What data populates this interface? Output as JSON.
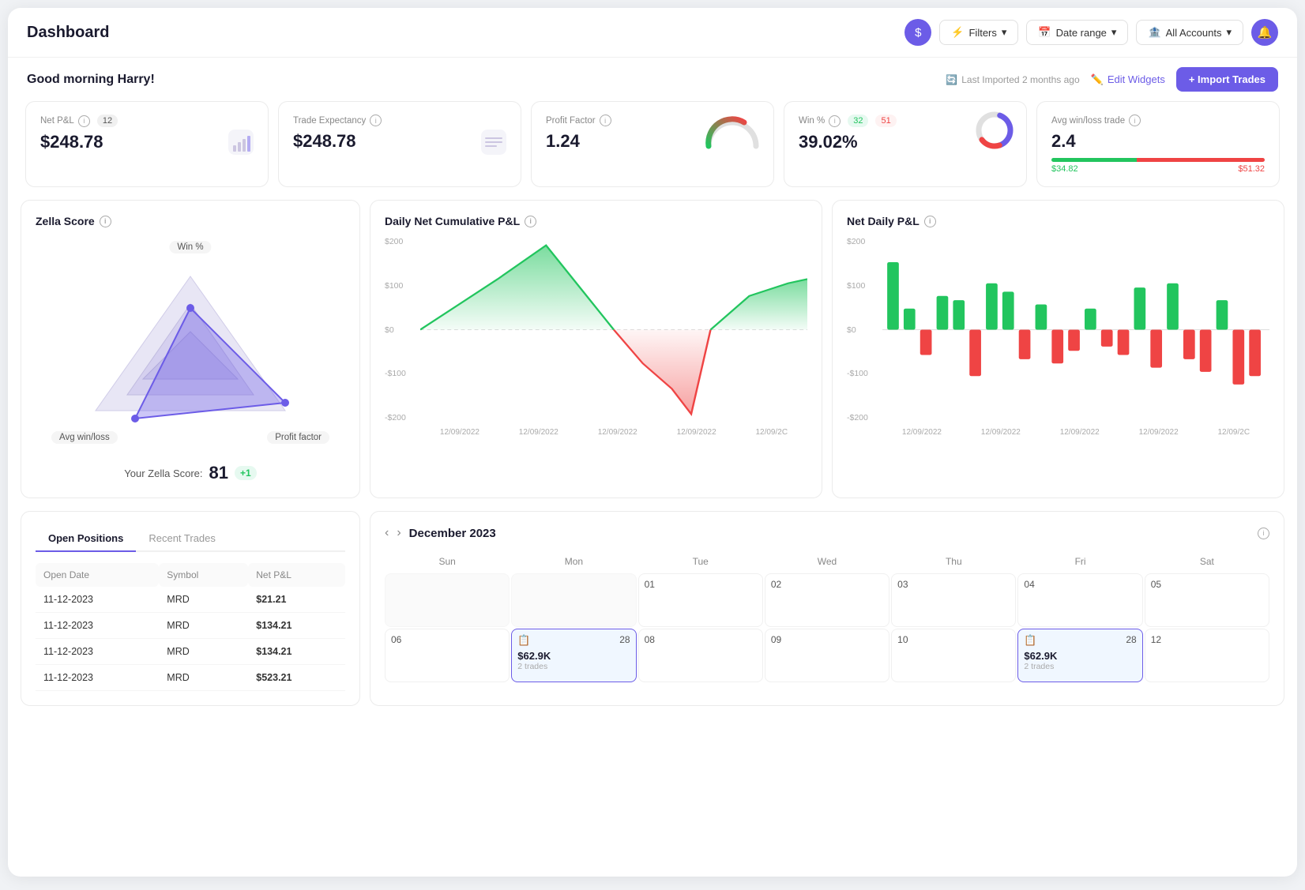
{
  "header": {
    "title": "Dashboard",
    "filters_label": "Filters",
    "date_range_label": "Date range",
    "all_accounts_label": "All Accounts"
  },
  "sub_header": {
    "greeting": "Good morning Harry!",
    "last_imported": "Last Imported 2 months ago",
    "edit_widgets_label": "Edit Widgets",
    "import_trades_label": "+ Import Trades"
  },
  "kpi": {
    "net_pnl": {
      "label": "Net P&L",
      "badge": "12",
      "value": "$248.78"
    },
    "trade_expectancy": {
      "label": "Trade Expectancy",
      "value": "$248.78"
    },
    "profit_factor": {
      "label": "Profit Factor",
      "value": "1.24"
    },
    "win_pct": {
      "label": "Win %",
      "badge_green": "32",
      "badge_red": "51",
      "value": "39.02%"
    },
    "avg_win_loss": {
      "label": "Avg win/loss trade",
      "value": "2.4",
      "green_label": "$34.82",
      "red_label": "$51.32"
    }
  },
  "zella": {
    "title": "Zella Score",
    "label_top": "Win %",
    "label_bl": "Avg win/loss",
    "label_br": "Profit factor",
    "score_label": "Your Zella Score:",
    "score": "81",
    "delta": "+1"
  },
  "daily_pnl": {
    "title": "Daily Net Cumulative P&L",
    "y_labels": [
      "$200",
      "$100",
      "$0",
      "-$100",
      "-$200"
    ],
    "x_labels": [
      "12/09/2022",
      "12/09/2022",
      "12/09/2022",
      "12/09/2022",
      "12/09/2C"
    ]
  },
  "net_daily_pnl": {
    "title": "Net Daily P&L",
    "y_labels": [
      "$200",
      "$100",
      "$0",
      "-$100",
      "-$200"
    ],
    "x_labels": [
      "12/09/2022",
      "12/09/2022",
      "12/09/2022",
      "12/09/2022",
      "12/09/2C"
    ]
  },
  "positions": {
    "tabs": [
      "Open Positions",
      "Recent Trades"
    ],
    "columns": [
      "Open Date",
      "Symbol",
      "Net P&L"
    ],
    "rows": [
      {
        "date": "11-12-2023",
        "symbol": "MRD",
        "pnl": "$21.21",
        "positive": true
      },
      {
        "date": "11-12-2023",
        "symbol": "MRD",
        "pnl": "$134.21",
        "positive": false
      },
      {
        "date": "11-12-2023",
        "symbol": "MRD",
        "pnl": "$134.21",
        "positive": true
      },
      {
        "date": "11-12-2023",
        "symbol": "MRD",
        "pnl": "$523.21",
        "positive": false
      }
    ]
  },
  "calendar": {
    "month": "December 2023",
    "day_headers": [
      "Sun",
      "Mon",
      "Tue",
      "Wed",
      "Thu",
      "Fri",
      "Sat"
    ],
    "cells": [
      {
        "day": "",
        "empty": true
      },
      {
        "day": "",
        "empty": true
      },
      {
        "day": "01",
        "empty": false
      },
      {
        "day": "02",
        "empty": false
      },
      {
        "day": "03",
        "empty": false
      },
      {
        "day": "04",
        "empty": false
      },
      {
        "day": "05",
        "empty": false
      },
      {
        "day": "06",
        "empty": false
      },
      {
        "day": "28",
        "empty": false,
        "has_data": true,
        "value": "$62.9K",
        "trades": "2 trades",
        "highlighted": true
      },
      {
        "day": "08",
        "empty": false
      },
      {
        "day": "09",
        "empty": false
      },
      {
        "day": "10",
        "empty": false
      },
      {
        "day": "28",
        "empty": false,
        "has_data": true,
        "value": "$62.9K",
        "trades": "2 trades",
        "highlighted": true
      },
      {
        "day": "12",
        "empty": false
      }
    ]
  }
}
